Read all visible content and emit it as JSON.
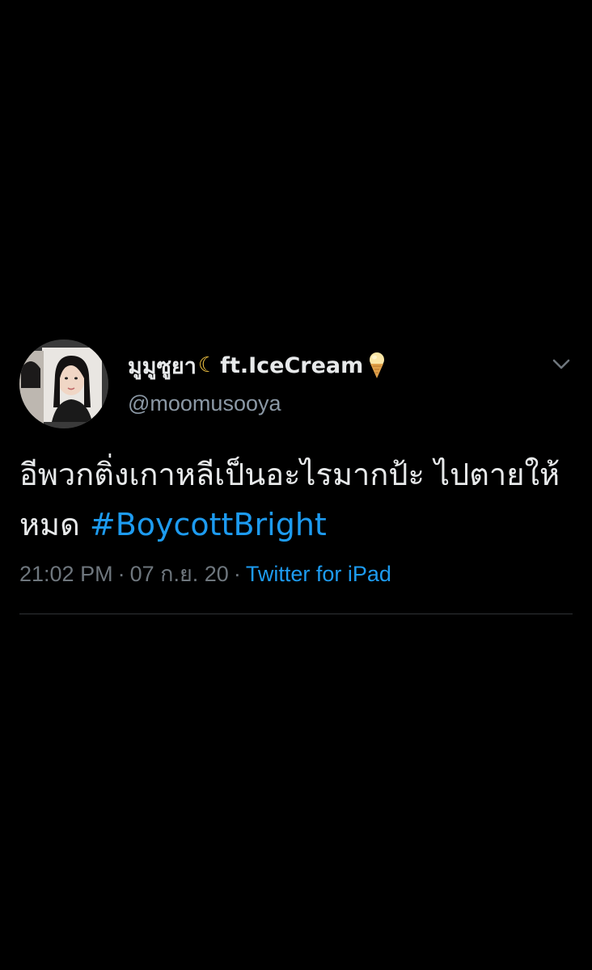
{
  "tweet": {
    "display_name_thai": "มูมูซูยา",
    "display_name_suffix": "ft.IceCream",
    "handle": "@moomusooya",
    "text_main": "อีพวกติ่งเกาหลีเป็นอะไรมากป้ะ ไปตายให้หมด ",
    "hashtag": "#BoycottBright",
    "time": "21:02 PM",
    "date": "07 ก.ย. 20",
    "source": "Twitter for iPad",
    "separator": "·"
  },
  "icons": {
    "moon": "crescent-moon-icon",
    "icecream": "ice-cream-icon",
    "menu": "chevron-down-icon"
  },
  "colors": {
    "background": "#000000",
    "text": "#e7e9ea",
    "secondary": "#8b98a5",
    "accent": "#1d9bf0"
  }
}
